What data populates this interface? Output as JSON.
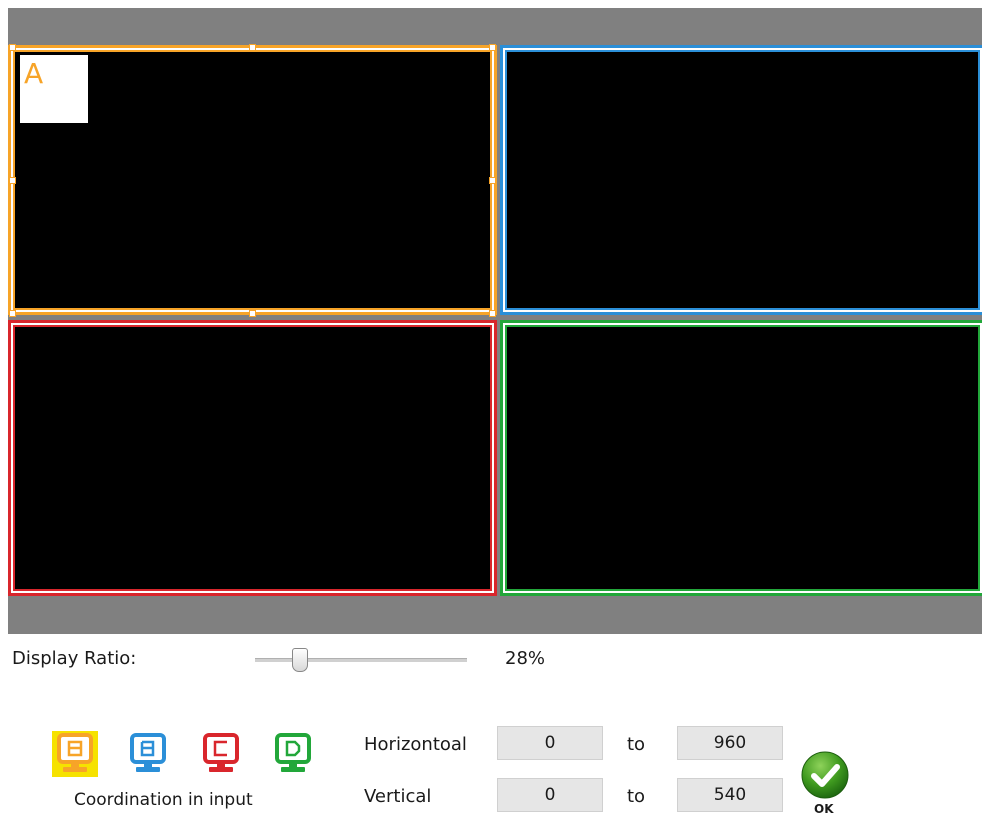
{
  "preview": {
    "window_a_label": "A"
  },
  "colors": {
    "window_a": "#f7a428",
    "window_b": "#2b8fd8",
    "window_c": "#d9262c",
    "window_d": "#22a73a",
    "selected_highlight": "#f6e200"
  },
  "display_ratio": {
    "label": "Display Ratio:",
    "value": "28%",
    "slider_fraction": 0.28
  },
  "windows_selector": {
    "buttons": [
      {
        "letter": "A",
        "icon": "monitor-a-icon",
        "selected": true
      },
      {
        "letter": "B",
        "icon": "monitor-b-icon",
        "selected": false
      },
      {
        "letter": "C",
        "icon": "monitor-c-icon",
        "selected": false
      },
      {
        "letter": "D",
        "icon": "monitor-d-icon",
        "selected": false
      }
    ],
    "caption": "Coordination in input"
  },
  "coordinates": {
    "horizontal_label": "Horizontoal",
    "vertical_label": "Vertical",
    "to_label": "to",
    "h_from": "0",
    "h_to": "960",
    "v_from": "0",
    "v_to": "540"
  },
  "ok_button": {
    "label": "OK",
    "icon": "checkmark-icon"
  }
}
